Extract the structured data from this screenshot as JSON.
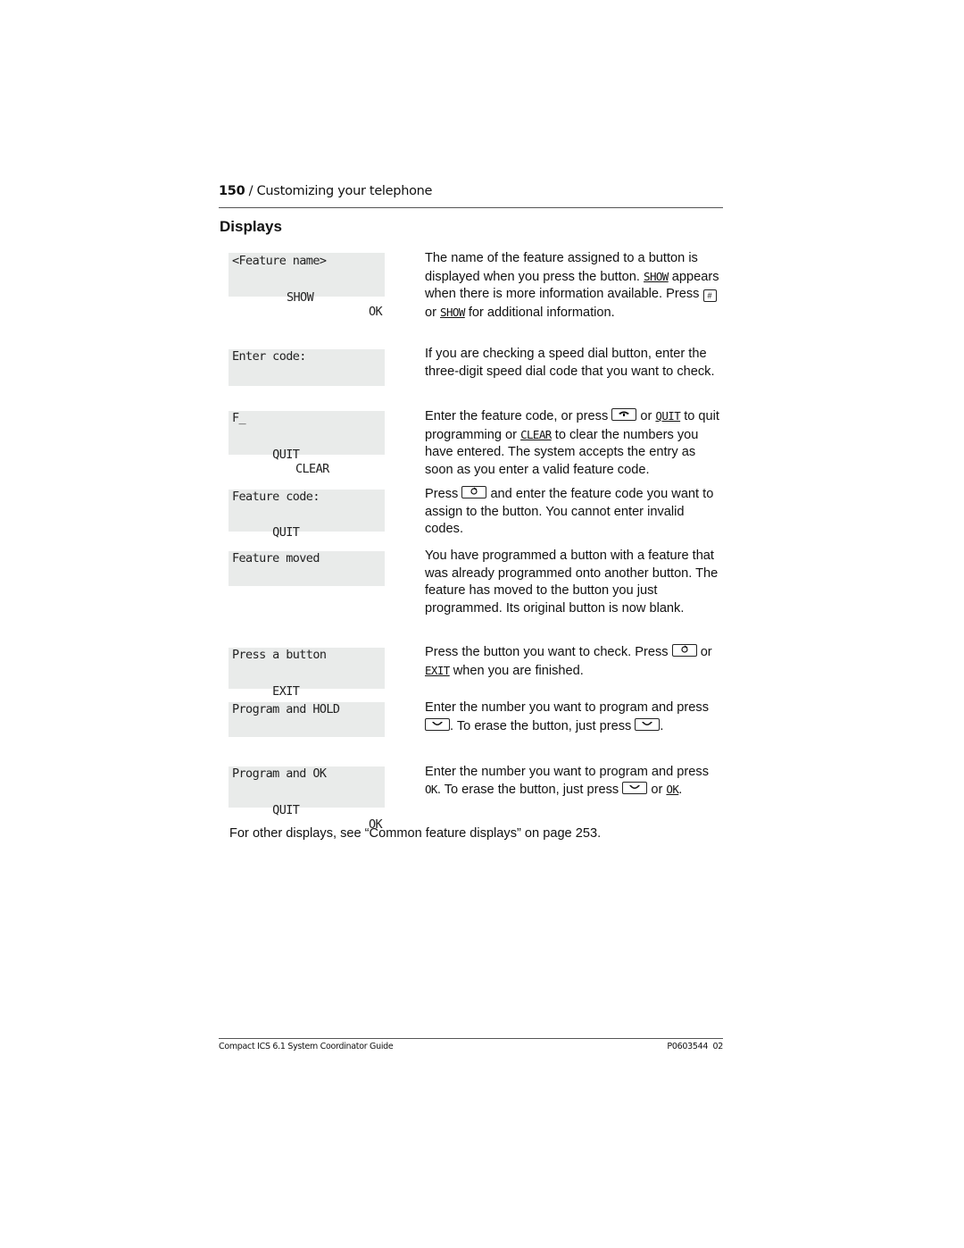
{
  "header": {
    "page_number": "150",
    "separator": " / ",
    "chapter": "Customizing your telephone"
  },
  "section_title": "Displays",
  "rows": [
    {
      "lcd": {
        "line1": "<Feature name>",
        "line2_mid": "SHOW",
        "line2_right": "OK"
      },
      "desc": {
        "p1": "The name of the feature assigned to a button is displayed when you press the button.",
        "show": "SHOW",
        "p2": "appears when there is more information available. Press",
        "hash_key": "#",
        "or": "or",
        "show2": "SHOW",
        "p3": "for additional information."
      }
    },
    {
      "lcd": {
        "line1": "Enter code:"
      },
      "desc": {
        "text": "If you are checking a speed dial button, enter the three-digit speed dial code that you want to check."
      }
    },
    {
      "lcd": {
        "line1": "F_",
        "line2_left": "QUIT",
        "line2_mid": "CLEAR"
      },
      "desc": {
        "p1": "Enter the feature code, or press",
        "or": "or",
        "quit": "QUIT",
        "p2": "to quit programming or",
        "clear": "CLEAR",
        "p3": "to clear the numbers you have entered. The system accepts the entry as soon as you enter a valid feature code."
      }
    },
    {
      "lcd": {
        "line1": "Feature code:",
        "line2_left": "QUIT"
      },
      "desc": {
        "p1": "Press",
        "p2": "and enter the feature code you want to assign to the button. You cannot enter invalid codes."
      }
    },
    {
      "lcd": {
        "line1": "Feature moved"
      },
      "desc": {
        "text": "You have programmed a button with a feature that was already programmed onto another button. The feature has moved to the button you just programmed. Its original button is now blank."
      }
    },
    {
      "lcd": {
        "line1": "Press a button",
        "line2_left": "EXIT"
      },
      "desc": {
        "p1": "Press the button you want to check. Press",
        "or": "or",
        "exit": "EXIT",
        "p2": "when you are finished."
      }
    },
    {
      "lcd": {
        "line1": "Program and HOLD"
      },
      "desc": {
        "p1": "Enter the number you want to program and press",
        "p2": ". To erase the button, just press",
        "p3": "."
      }
    },
    {
      "lcd": {
        "line1": "Program and OK",
        "line2_left": "QUIT",
        "line2_right": "OK"
      },
      "desc": {
        "p1": "Enter the number you want to program and press",
        "ok": "OK",
        "p2": ". To erase the button, just press",
        "or": "or",
        "ok2": "OK",
        "p3": "."
      }
    }
  ],
  "icons": {
    "hash": "hash-key-icon",
    "release": "release-key-icon",
    "feature": "feature-key-icon",
    "hold": "hold-key-icon"
  },
  "note": "For other displays, see “Common feature displays” on page 253.",
  "footer": {
    "title": "Compact ICS 6.1 System Coordinator Guide",
    "doc_number": "P0603544  02"
  }
}
